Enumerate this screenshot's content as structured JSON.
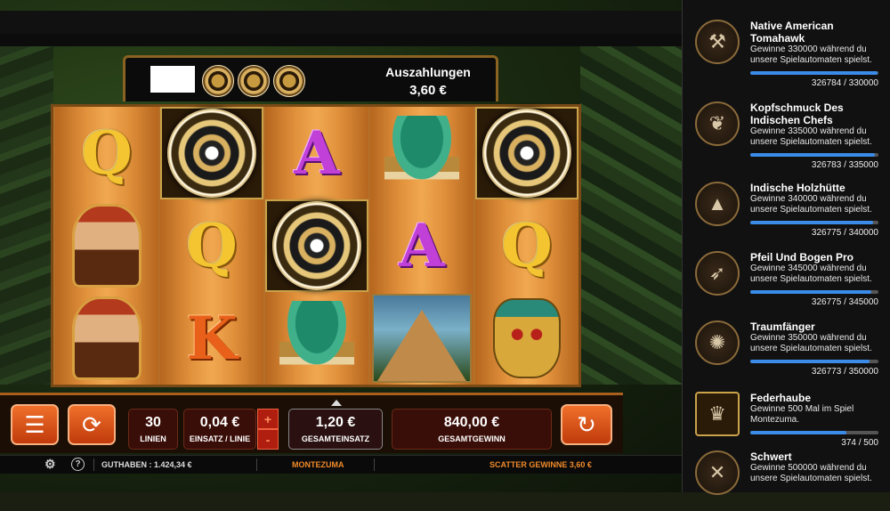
{
  "header": {
    "payouts_label": "Auszahlungen",
    "payouts_value": "3,60 €"
  },
  "reels": [
    [
      {
        "type": "letter",
        "letter": "Q",
        "cls": "sym-q",
        "name": "symbol-q"
      },
      {
        "type": "woman",
        "name": "symbol-princess"
      },
      {
        "type": "woman",
        "name": "symbol-princess"
      }
    ],
    [
      {
        "type": "scatter",
        "name": "symbol-aztec-calendar-scatter"
      },
      {
        "type": "letter",
        "letter": "Q",
        "cls": "sym-q",
        "name": "symbol-q"
      },
      {
        "type": "letter",
        "letter": "K",
        "cls": "sym-k",
        "name": "symbol-k"
      }
    ],
    [
      {
        "type": "letter",
        "letter": "A",
        "cls": "sym-a",
        "name": "symbol-a"
      },
      {
        "type": "scatter",
        "name": "symbol-aztec-calendar-scatter"
      },
      {
        "type": "headdress",
        "name": "symbol-feather-headdress"
      }
    ],
    [
      {
        "type": "headdress",
        "name": "symbol-feather-headdress"
      },
      {
        "type": "letter",
        "letter": "A",
        "cls": "sym-a",
        "name": "symbol-a"
      },
      {
        "type": "pyramid",
        "name": "symbol-pyramid"
      }
    ],
    [
      {
        "type": "scatter",
        "name": "symbol-aztec-calendar-scatter"
      },
      {
        "type": "letter",
        "letter": "Q",
        "cls": "sym-q",
        "name": "symbol-q"
      },
      {
        "type": "mask",
        "name": "symbol-golden-mask"
      }
    ]
  ],
  "controls": {
    "lines_value": "30",
    "lines_label": "LINIEN",
    "bet_per_line_value": "0,04 €",
    "bet_per_line_label": "EINSATZ / LINIE",
    "stepper_plus": "+",
    "stepper_minus": "-",
    "total_bet_value": "1,20 €",
    "total_bet_label": "GESAMTEINSATZ",
    "total_win_value": "840,00 €",
    "total_win_label": "GESAMTGEWINN"
  },
  "status": {
    "balance": "GUTHABEN : 1.424,34 €",
    "game_name": "MONTEZUMA",
    "scatter_win": "SCATTER GEWINNE 3,60 €",
    "help": "?"
  },
  "achievements": [
    {
      "title": "Native American Tomahawk",
      "desc": "Gewinne 330000 während du unsere Spielautomaten spielst.",
      "count": "326784 / 330000",
      "progress": 0.99,
      "icon": "tomahawk-icon",
      "glyph": "⚒"
    },
    {
      "title": "Kopfschmuck Des Indischen Chefs",
      "desc": "Gewinne 335000 während du unsere Spielautomaten spielst.",
      "count": "326783 / 335000",
      "progress": 0.975,
      "icon": "war-bonnet-icon",
      "glyph": "❦"
    },
    {
      "title": "Indische Holzhütte",
      "desc": "Gewinne 340000 während du unsere Spielautomaten spielst.",
      "count": "326775 / 340000",
      "progress": 0.961,
      "icon": "tipi-icon",
      "glyph": "▲"
    },
    {
      "title": "Pfeil Und Bogen Pro",
      "desc": "Gewinne 345000 während du unsere Spielautomaten spielst.",
      "count": "326775 / 345000",
      "progress": 0.947,
      "icon": "bow-arrow-icon",
      "glyph": "➶"
    },
    {
      "title": "Traumfänger",
      "desc": "Gewinne 350000 während du unsere Spielautomaten spielst.",
      "count": "326773 / 350000",
      "progress": 0.934,
      "icon": "dreamcatcher-icon",
      "glyph": "✺"
    },
    {
      "title": "Federhaube",
      "desc": "Gewinne 500 Mal im Spiel Montezuma.",
      "count": "374 / 500",
      "progress": 0.748,
      "icon": "feather-headdress-icon",
      "glyph": "♛"
    },
    {
      "title": "Schwert",
      "desc": "Gewinne 500000 während du unsere Spielautomaten spielst.",
      "count": "",
      "progress": 0,
      "icon": "sword-icon",
      "glyph": "✕"
    }
  ]
}
